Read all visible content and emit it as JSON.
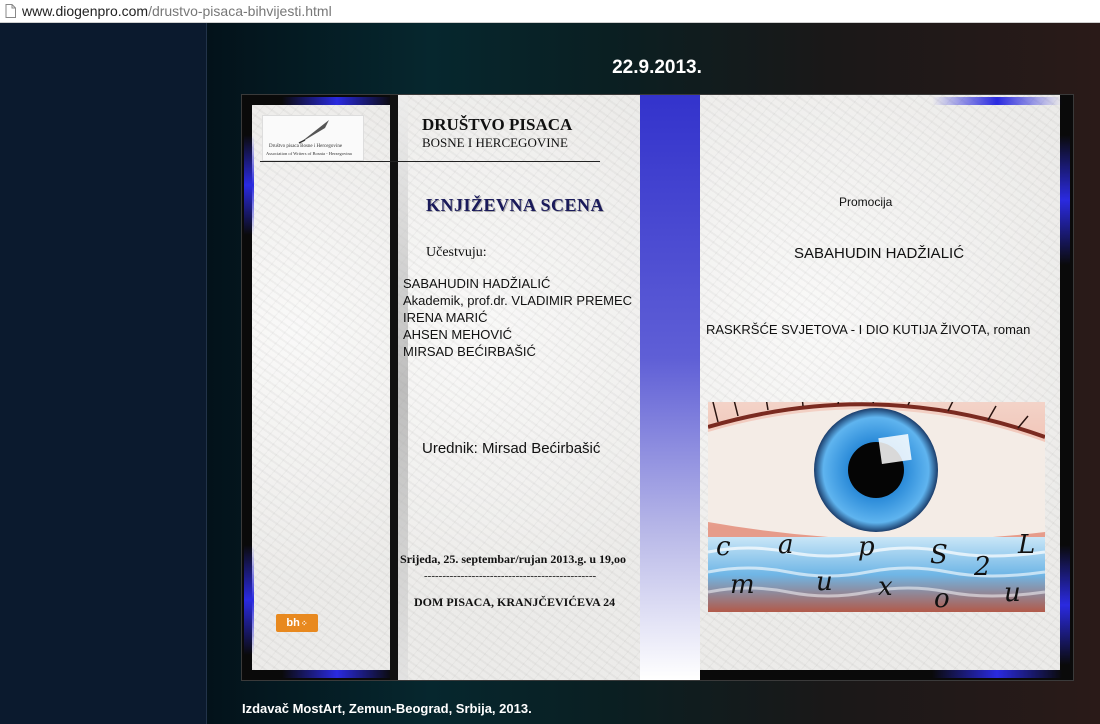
{
  "browser": {
    "url_domain": "www.diogenpro.com",
    "url_path": "/drustvo-pisaca-bihvijesti.html"
  },
  "page": {
    "date": "22.9.2013.",
    "footer": "Izdavač MostArt, Zemun-Beograd, Srbija, 2013."
  },
  "poster": {
    "logo_caption_line1": "Društvo pisaca Bosne i Hercegovine",
    "logo_caption_line2": "Association of Writers of Bosnia - Herzegovina",
    "org_line1": "DRUŠTVO PISACA",
    "org_line2": "BOSNE I HERCEGOVINE",
    "event_title": "KNJIŽEVNA SCENA",
    "participants_label": "Učestvuju:",
    "participants": [
      "SABAHUDIN HADŽIALIĆ",
      "Akademik, prof.dr. VLADIMIR PREMEC",
      "IRENA MARIĆ",
      "AHSEN MEHOVIĆ",
      "MIRSAD BEĆIRBAŠIĆ"
    ],
    "editor": "Urednik: Mirsad Bećirbašić",
    "when": "Srijeda, 25. septembar/rujan 2013.g.  u 19,oo",
    "divider": "-----------------------------------------------",
    "where": "DOM PISACA, KRANJČEVIĆEVA 24",
    "badge": "bh",
    "promo_label": "Promocija",
    "author": "SABAHUDIN HADŽIALIĆ",
    "book_title": "RASKRŠĆE SVJETOVA - I DIO KUTIJA ŽIVOTA, roman",
    "cover_letters_top": [
      "c",
      "a",
      "p",
      "S",
      "L"
    ],
    "cover_letters_bottom": [
      "m",
      "u",
      "x",
      "2",
      "o",
      "u"
    ]
  },
  "colors": {
    "glow_blue": "#2a2ae0",
    "spine_blue": "#3333cc",
    "iris": "#2a8ad8"
  }
}
